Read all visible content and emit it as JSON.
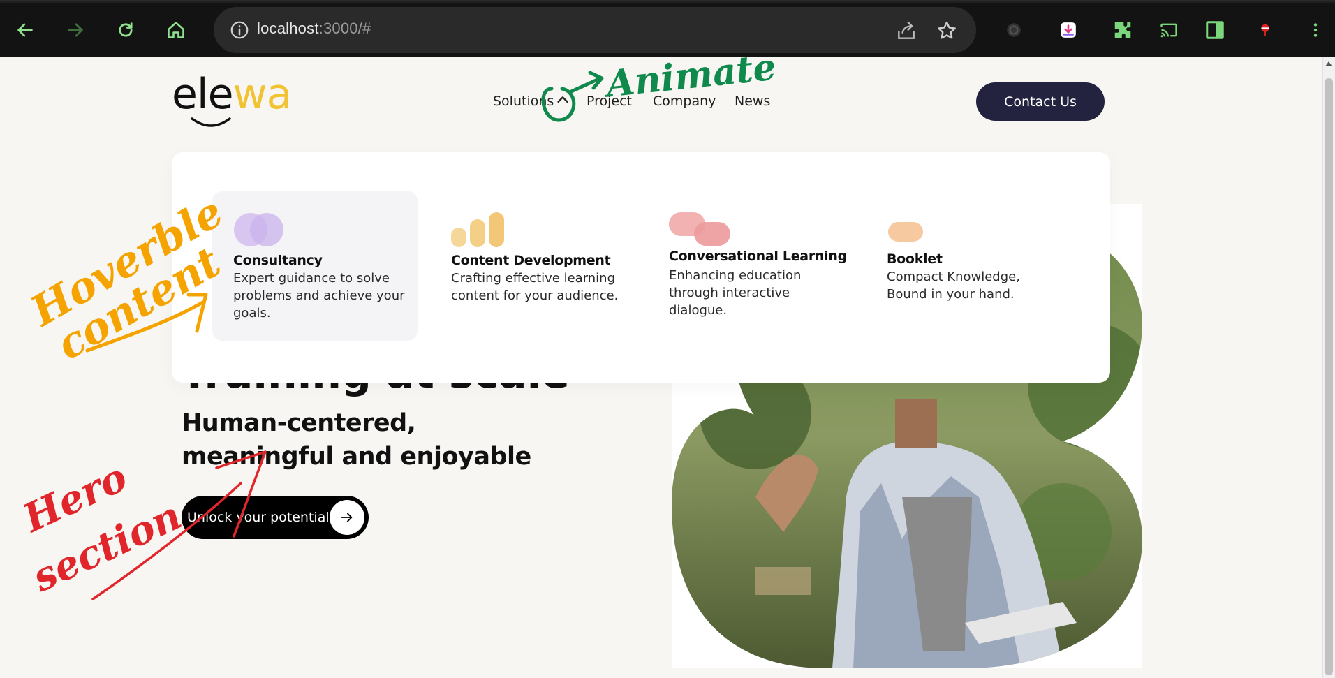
{
  "browser": {
    "url_host": "localhost",
    "url_rest": ":3000/#"
  },
  "site": {
    "logo_primary": "ele",
    "logo_accent": "wa",
    "nav": {
      "solutions": "Solutions",
      "project": "Project",
      "company": "Company",
      "news": "News"
    },
    "contact_label": "Contact Us"
  },
  "dropdown": {
    "items": [
      {
        "title": "Consultancy",
        "desc": "Expert guidance to solve problems and achieve your goals."
      },
      {
        "title": "Content Development",
        "desc": "Crafting effective learning content for your audience."
      },
      {
        "title": "Conversational Learning",
        "desc": "Enhancing education through interactive dialogue."
      },
      {
        "title": "Booklet",
        "desc": "Compact Knowledge, Bound in your hand."
      }
    ]
  },
  "hero": {
    "title_partial": "Training at scale",
    "subtitle": "Human-centered, meaningful and enjoyable",
    "cta_label": "Unlock your potential"
  },
  "annotations": {
    "animate": "Animate",
    "hoverable_1": "Hoverble",
    "hoverable_2": "content",
    "hero_1": "Hero",
    "hero_2": "section"
  },
  "colors": {
    "brand_dark": "#23223f",
    "brand_yellow": "#f1c232",
    "annotation_green": "#0f8a4c",
    "annotation_orange": "#f5a300",
    "annotation_red": "#e0262b"
  }
}
